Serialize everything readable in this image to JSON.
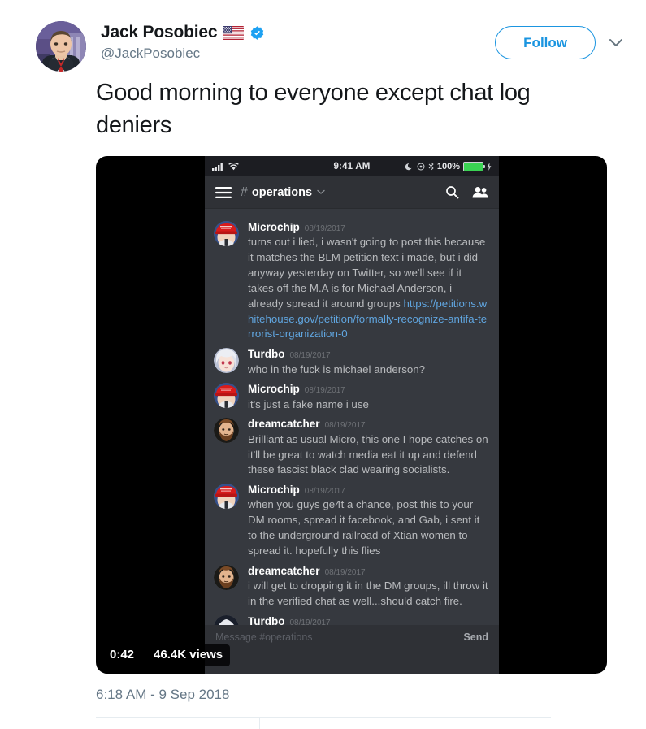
{
  "profile": {
    "display_name": "Jack Posobiec",
    "handle": "@JackPosobiec",
    "flag_icon": "us-flag-icon",
    "verified_icon": "verified-badge-icon",
    "avatar_icon": "profile-avatar"
  },
  "actions": {
    "follow_label": "Follow",
    "caret_icon": "chevron-down-icon"
  },
  "tweet": {
    "text": "Good morning to everyone except chat log deniers",
    "timestamp": "6:18 AM - 9 Sep 2018"
  },
  "video": {
    "duration": "0:42",
    "views": "46.4K views"
  },
  "phone": {
    "status_bar": {
      "signal_icon": "cellular-signal-icon",
      "wifi_icon": "wifi-icon",
      "time": "9:41 AM",
      "moon_icon": "moon-icon",
      "dnd_icon": "do-not-disturb-icon",
      "bluetooth_icon": "bluetooth-icon",
      "battery_percent": "100%",
      "battery_icon": "battery-full-icon",
      "charging_icon": "charging-bolt-icon"
    }
  },
  "discord": {
    "menu_icon": "hamburger-menu-icon",
    "hash": "#",
    "channel_name": "operations",
    "channel_caret_icon": "chevron-down-icon",
    "search_icon": "search-icon",
    "members_icon": "members-icon",
    "input_placeholder": "Message #operations",
    "send_label": "Send",
    "messages": [
      {
        "author": "Microchip",
        "time": "08/19/2017",
        "avatar": "microchip-avatar",
        "text": "turns out i lied, i wasn't going to post this because it matches the BLM petition text i made, but i did anyway yesterday on Twitter, so we'll see if it takes off the M.A is for Michael Anderson, i already spread it around groups ",
        "link": "https://petitions.whitehouse.gov/petition/formally-recognize-antifa-terrorist-organization-0"
      },
      {
        "author": "Turdbo",
        "time": "08/19/2017",
        "avatar": "turdbo-avatar",
        "text": "who in the fuck is michael anderson?",
        "link": ""
      },
      {
        "author": "Microchip",
        "time": "08/19/2017",
        "avatar": "microchip-avatar",
        "text": "it's just a fake name i use",
        "link": ""
      },
      {
        "author": "dreamcatcher",
        "time": "08/19/2017",
        "avatar": "dreamcatcher-avatar",
        "text": "Brilliant as usual Micro, this one I hope catches on it'll be great to watch media eat it up and defend these fascist black clad wearing socialists.",
        "link": ""
      },
      {
        "author": "Microchip",
        "time": "08/19/2017",
        "avatar": "microchip-avatar",
        "text": "when you guys ge4t a chance, post this to your DM rooms, spread it facebook, and Gab, i sent it to the underground railroad of Xtian women to spread it. hopefully this flies",
        "link": ""
      },
      {
        "author": "dreamcatcher",
        "time": "08/19/2017",
        "avatar": "dreamcatcher-avatar",
        "text": "i will get to dropping it in the DM groups, ill throw it in the verified chat as well...should catch fire.",
        "link": ""
      },
      {
        "author": "Turdbo",
        "time": "08/19/2017",
        "avatar": "turdbo2-avatar",
        "text": "",
        "link": ""
      }
    ]
  },
  "colors": {
    "twitter_blue": "#1b95e0",
    "verified_blue": "#1da1f2",
    "discord_bg": "#36393f",
    "discord_header": "#2f3136",
    "link_blue": "#60a5df",
    "battery_green": "#3ad353"
  }
}
